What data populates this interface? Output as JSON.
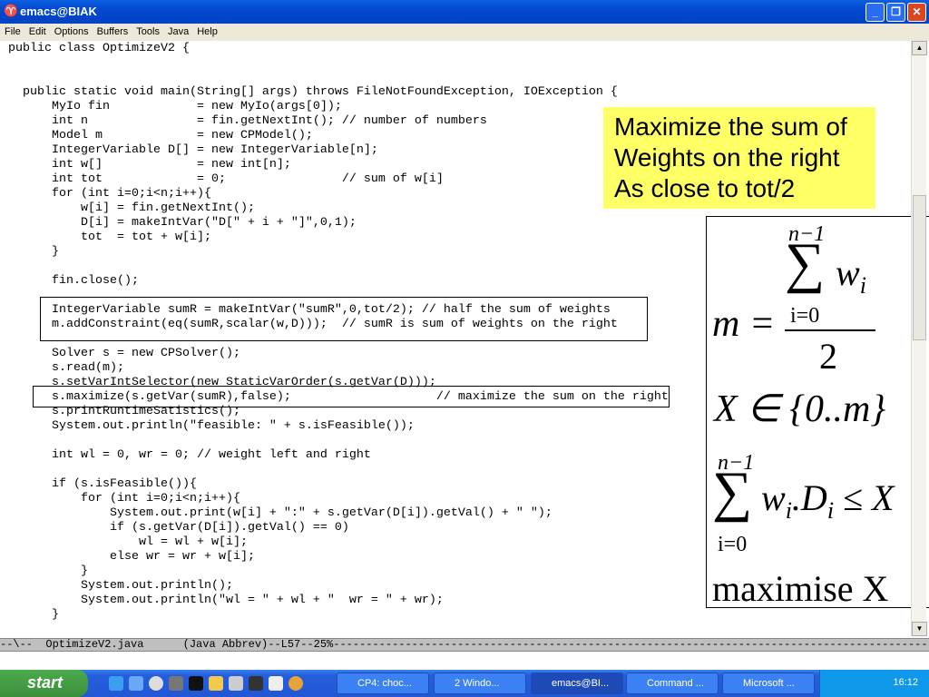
{
  "window": {
    "title": "emacs@BIAK"
  },
  "menu": [
    "File",
    "Edit",
    "Options",
    "Buffers",
    "Tools",
    "Java",
    "Help"
  ],
  "code_lines": [
    "public class OptimizeV2 {",
    "",
    "",
    "  public static void main(String[] args) throws FileNotFoundException, IOException {",
    "      MyIo fin            = new MyIo(args[0]);",
    "      int n               = fin.getNextInt(); // number of numbers",
    "      Model m             = new CPModel();",
    "      IntegerVariable D[] = new IntegerVariable[n];",
    "      int w[]             = new int[n];",
    "      int tot             = 0;                // sum of w[i]",
    "      for (int i=0;i<n;i++){",
    "          w[i] = fin.getNextInt();",
    "          D[i] = makeIntVar(\"D[\" + i + \"]\",0,1);",
    "          tot  = tot + w[i];",
    "      }",
    "",
    "      fin.close();",
    "",
    "      IntegerVariable sumR = makeIntVar(\"sumR\",0,tot/2); // half the sum of weights",
    "      m.addConstraint(eq(sumR,scalar(w,D)));  // sumR is sum of weights on the right",
    "",
    "      Solver s = new CPSolver();",
    "      s.read(m);",
    "      s.setVarIntSelector(new StaticVarOrder(s.getVar(D)));",
    "      s.maximize(s.getVar(sumR),false);                    // maximize the sum on the right",
    "      s.printRuntimeSatistics();",
    "      System.out.println(\"feasible: \" + s.isFeasible());",
    "",
    "      int wl = 0, wr = 0; // weight left and right",
    "",
    "      if (s.isFeasible()){",
    "          for (int i=0;i<n;i++){",
    "              System.out.print(w[i] + \":\" + s.getVar(D[i]).getVal() + \" \");",
    "              if (s.getVar(D[i]).getVal() == 0)",
    "                  wl = wl + w[i];",
    "              else wr = wr + w[i];",
    "          }",
    "          System.out.println();",
    "          System.out.println(\"wl = \" + wl + \"  wr = \" + wr);",
    "      }"
  ],
  "note": {
    "line1": "Maximize the sum of",
    "line2": "Weights on the right",
    "line3": "As close to tot/2"
  },
  "math": {
    "m": "m =",
    "sum": "∑",
    "upper": "n−1",
    "lower": "i=0",
    "wi": "w",
    "i": "i",
    "den": "2",
    "xin": "X ∈ {0..m}",
    "sum2_body": "w",
    "dot": ".D",
    "le": "≤ X",
    "max": "maximise X"
  },
  "modeline": "--\\--  OptimizeV2.java      (Java Abbrev)--L57--25%---------------------------------------------------------------------------------------------------",
  "taskbar": {
    "start": "start",
    "buttons": [
      "CP4: choc...",
      "2 Windo...",
      "emacs@BI...",
      "Command ...",
      "Microsoft ..."
    ],
    "clock": "16:12"
  }
}
